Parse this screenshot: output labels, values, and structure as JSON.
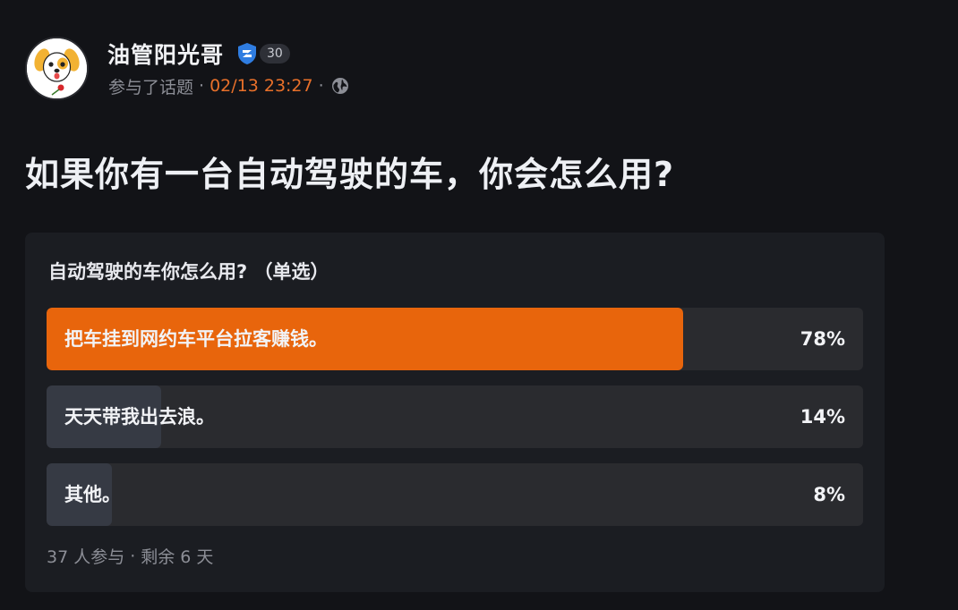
{
  "post": {
    "author_name": "油管阳光哥",
    "level": "30",
    "meta_prefix": "参与了话题",
    "time": "02/13 23:27",
    "separator": "·",
    "title": "如果你有一台自动驾驶的车，你会怎么用?",
    "avatar_icon": "puppy-avatar",
    "verify_icon": "verified-shield-icon",
    "visibility_icon": "globe-icon"
  },
  "poll": {
    "question": "自动驾驶的车你怎么用? （单选）",
    "options": [
      {
        "label": "把车挂到网约车平台拉客赚钱。",
        "percent_text": "78%",
        "percent": 78,
        "fill_color": "#e8650c",
        "selected": true
      },
      {
        "label": "天天带我出去浪。",
        "percent_text": "14%",
        "percent": 14,
        "fill_color": "#363a44",
        "selected": false
      },
      {
        "label": "其他。",
        "percent_text": "8%",
        "percent": 8,
        "fill_color": "#363a44",
        "selected": false
      }
    ],
    "participants": "37 人参与",
    "separator": "·",
    "remaining": "剩余 6 天"
  },
  "colors": {
    "background": "#121317",
    "card": "#1b1d22",
    "accent": "#e8650c",
    "time": "#e8702a",
    "verify_blue": "#2f7de1"
  }
}
